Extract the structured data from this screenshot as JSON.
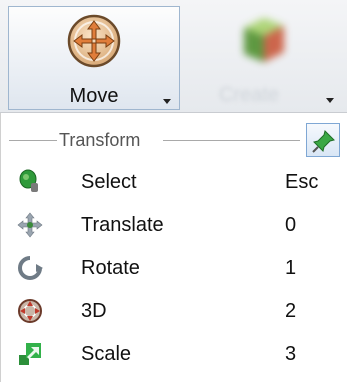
{
  "toolbar": {
    "move_label": "Move",
    "create_label": "Create"
  },
  "menu": {
    "section_title": "Transform",
    "items": [
      {
        "label": "Select",
        "shortcut": "Esc",
        "icon": "select-icon"
      },
      {
        "label": "Translate",
        "shortcut": "0",
        "icon": "translate-icon"
      },
      {
        "label": "Rotate",
        "shortcut": "1",
        "icon": "rotate-icon"
      },
      {
        "label": "3D",
        "shortcut": "2",
        "icon": "3d-icon"
      },
      {
        "label": "Scale",
        "shortcut": "3",
        "icon": "scale-icon"
      }
    ]
  },
  "colors": {
    "accent_green": "#2f9a3a",
    "move_icon_orange": "#e07d3a",
    "pin_border": "#7fa7d4"
  }
}
